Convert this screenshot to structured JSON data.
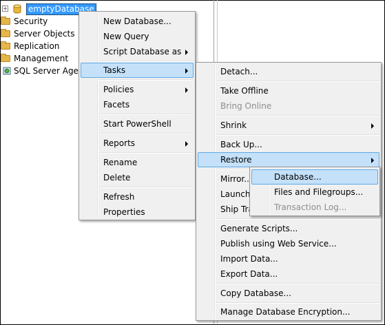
{
  "tree": {
    "database_label": "emptyDatabase",
    "expander_symbol": "+",
    "items": [
      {
        "label": "Security",
        "icon": "folder-icon"
      },
      {
        "label": "Server Objects",
        "icon": "folder-icon"
      },
      {
        "label": "Replication",
        "icon": "folder-icon"
      },
      {
        "label": "Management",
        "icon": "folder-icon"
      },
      {
        "label": "SQL Server Agent",
        "icon": "sql-agent-icon"
      }
    ]
  },
  "context_menu": {
    "items": [
      {
        "label": "New Database..."
      },
      {
        "label": "New Query"
      },
      {
        "label": "Script Database as"
      },
      {
        "label": "Tasks"
      },
      {
        "label": "Policies"
      },
      {
        "label": "Facets"
      },
      {
        "label": "Start PowerShell"
      },
      {
        "label": "Reports"
      },
      {
        "label": "Rename"
      },
      {
        "label": "Delete"
      },
      {
        "label": "Refresh"
      },
      {
        "label": "Properties"
      }
    ]
  },
  "tasks_menu": {
    "items": [
      {
        "label": "Detach..."
      },
      {
        "label": "Take Offline"
      },
      {
        "label": "Bring Online"
      },
      {
        "label": "Shrink"
      },
      {
        "label": "Back Up..."
      },
      {
        "label": "Restore"
      },
      {
        "label": "Mirror..."
      },
      {
        "label": "Launch"
      },
      {
        "label": "Ship Tra"
      },
      {
        "label": "Generate Scripts..."
      },
      {
        "label": "Publish using Web Service..."
      },
      {
        "label": "Import Data..."
      },
      {
        "label": "Export Data..."
      },
      {
        "label": "Copy Database..."
      },
      {
        "label": "Manage Database Encryption..."
      }
    ]
  },
  "restore_menu": {
    "items": [
      {
        "label": "Database..."
      },
      {
        "label": "Files and Filegroups..."
      },
      {
        "label": "Transaction Log..."
      }
    ]
  },
  "colors": {
    "selection_fill": "#c4e1f9",
    "selection_border": "#5fa8e6",
    "tree_selection": "#3399ff",
    "menu_background": "#f0f0f0",
    "disabled_text": "#8d8d8d"
  }
}
